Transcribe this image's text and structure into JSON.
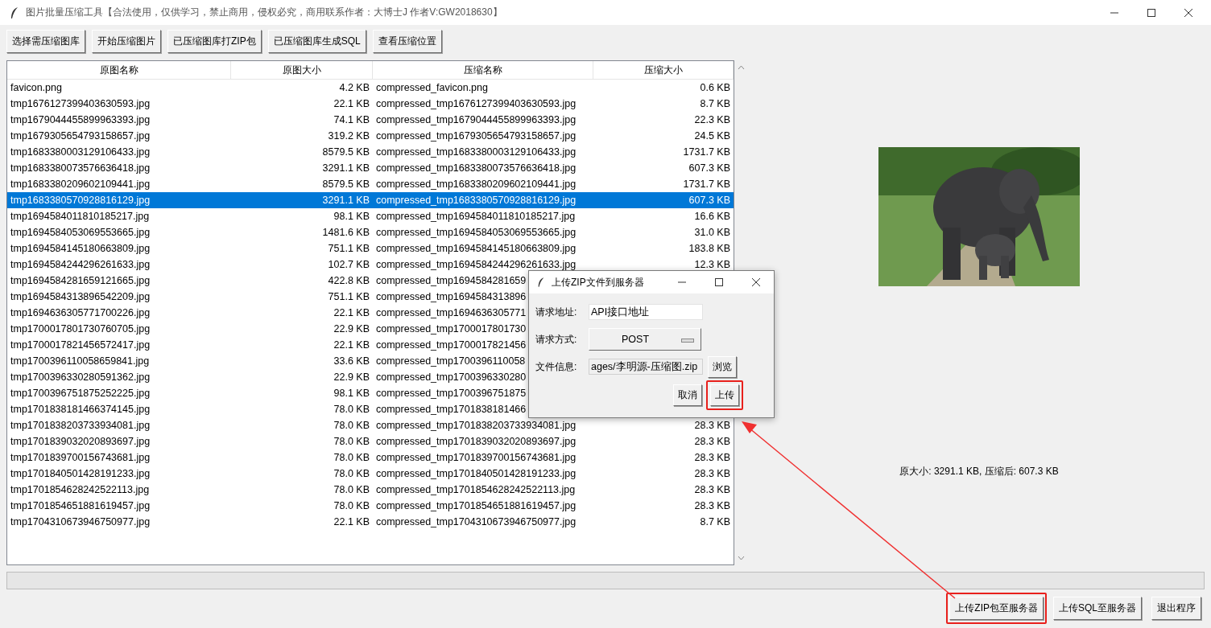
{
  "window": {
    "title": "图片批量压缩工具【合法使用，仅供学习，禁止商用，侵权必究，商用联系作者：大博士J 作者V:GW2018630】"
  },
  "toolbar": [
    "选择需压缩图库",
    "开始压缩图片",
    "已压缩图库打ZIP包",
    "已压缩图库生成SQL",
    "查看压缩位置"
  ],
  "table": {
    "columns": [
      "原图名称",
      "原图大小",
      "压缩名称",
      "压缩大小"
    ],
    "rows": [
      {
        "name": "favicon.png",
        "size": "4.2 KB",
        "compressed_name": "compressed_favicon.png",
        "compressed_size": "0.6 KB",
        "selected": false
      },
      {
        "name": "tmp1676127399403630593.jpg",
        "size": "22.1 KB",
        "compressed_name": "compressed_tmp1676127399403630593.jpg",
        "compressed_size": "8.7 KB",
        "selected": false
      },
      {
        "name": "tmp1679044455899963393.jpg",
        "size": "74.1 KB",
        "compressed_name": "compressed_tmp1679044455899963393.jpg",
        "compressed_size": "22.3 KB",
        "selected": false
      },
      {
        "name": "tmp1679305654793158657.jpg",
        "size": "319.2 KB",
        "compressed_name": "compressed_tmp1679305654793158657.jpg",
        "compressed_size": "24.5 KB",
        "selected": false
      },
      {
        "name": "tmp1683380003129106433.jpg",
        "size": "8579.5 KB",
        "compressed_name": "compressed_tmp1683380003129106433.jpg",
        "compressed_size": "1731.7 KB",
        "selected": false
      },
      {
        "name": "tmp1683380073576636418.jpg",
        "size": "3291.1 KB",
        "compressed_name": "compressed_tmp1683380073576636418.jpg",
        "compressed_size": "607.3 KB",
        "selected": false
      },
      {
        "name": "tmp1683380209602109441.jpg",
        "size": "8579.5 KB",
        "compressed_name": "compressed_tmp1683380209602109441.jpg",
        "compressed_size": "1731.7 KB",
        "selected": false
      },
      {
        "name": "tmp1683380570928816129.jpg",
        "size": "3291.1 KB",
        "compressed_name": "compressed_tmp1683380570928816129.jpg",
        "compressed_size": "607.3 KB",
        "selected": true
      },
      {
        "name": "tmp1694584011810185217.jpg",
        "size": "98.1 KB",
        "compressed_name": "compressed_tmp1694584011810185217.jpg",
        "compressed_size": "16.6 KB",
        "selected": false
      },
      {
        "name": "tmp1694584053069553665.jpg",
        "size": "1481.6 KB",
        "compressed_name": "compressed_tmp1694584053069553665.jpg",
        "compressed_size": "31.0 KB",
        "selected": false
      },
      {
        "name": "tmp1694584145180663809.jpg",
        "size": "751.1 KB",
        "compressed_name": "compressed_tmp1694584145180663809.jpg",
        "compressed_size": "183.8 KB",
        "selected": false
      },
      {
        "name": "tmp1694584244296261633.jpg",
        "size": "102.7 KB",
        "compressed_name": "compressed_tmp1694584244296261633.jpg",
        "compressed_size": "12.3 KB",
        "selected": false
      },
      {
        "name": "tmp1694584281659121665.jpg",
        "size": "422.8 KB",
        "compressed_name": "compressed_tmp1694584281659",
        "selected": false
      },
      {
        "name": "tmp1694584313896542209.jpg",
        "size": "751.1 KB",
        "compressed_name": "compressed_tmp1694584313896",
        "selected": false
      },
      {
        "name": "tmp1694636305771700226.jpg",
        "size": "22.1 KB",
        "compressed_name": "compressed_tmp1694636305771",
        "selected": false
      },
      {
        "name": "tmp1700017801730760705.jpg",
        "size": "22.9 KB",
        "compressed_name": "compressed_tmp1700017801730",
        "selected": false
      },
      {
        "name": "tmp1700017821456572417.jpg",
        "size": "22.1 KB",
        "compressed_name": "compressed_tmp1700017821456",
        "selected": false
      },
      {
        "name": "tmp1700396110058659841.jpg",
        "size": "33.6 KB",
        "compressed_name": "compressed_tmp1700396110058",
        "selected": false
      },
      {
        "name": "tmp1700396330280591362.jpg",
        "size": "22.9 KB",
        "compressed_name": "compressed_tmp1700396330280",
        "selected": false
      },
      {
        "name": "tmp1700396751875252225.jpg",
        "size": "98.1 KB",
        "compressed_name": "compressed_tmp1700396751875",
        "selected": false
      },
      {
        "name": "tmp1701838181466374145.jpg",
        "size": "78.0 KB",
        "compressed_name": "compressed_tmp1701838181466",
        "selected": false
      },
      {
        "name": "tmp1701838203733934081.jpg",
        "size": "78.0 KB",
        "compressed_name": "compressed_tmp1701838203733934081.jpg",
        "compressed_size": "28.3 KB",
        "selected": false
      },
      {
        "name": "tmp1701839032020893697.jpg",
        "size": "78.0 KB",
        "compressed_name": "compressed_tmp1701839032020893697.jpg",
        "compressed_size": "28.3 KB",
        "selected": false
      },
      {
        "name": "tmp1701839700156743681.jpg",
        "size": "78.0 KB",
        "compressed_name": "compressed_tmp1701839700156743681.jpg",
        "compressed_size": "28.3 KB",
        "selected": false
      },
      {
        "name": "tmp1701840501428191233.jpg",
        "size": "78.0 KB",
        "compressed_name": "compressed_tmp1701840501428191233.jpg",
        "compressed_size": "28.3 KB",
        "selected": false
      },
      {
        "name": "tmp1701854628242522113.jpg",
        "size": "78.0 KB",
        "compressed_name": "compressed_tmp1701854628242522113.jpg",
        "compressed_size": "28.3 KB",
        "selected": false
      },
      {
        "name": "tmp1701854651881619457.jpg",
        "size": "78.0 KB",
        "compressed_name": "compressed_tmp1701854651881619457.jpg",
        "compressed_size": "28.3 KB",
        "selected": false
      },
      {
        "name": "tmp1704310673946750977.jpg",
        "size": "22.1 KB",
        "compressed_name": "compressed_tmp1704310673946750977.jpg",
        "compressed_size": "8.7 KB",
        "selected": false
      }
    ]
  },
  "preview": {
    "caption": "原大小: 3291.1 KB, 压缩后: 607.3 KB"
  },
  "buttons": [
    {
      "label": "上传ZIP包至服务器",
      "highlighted": true
    },
    {
      "label": "上传SQL至服务器",
      "highlighted": false
    },
    {
      "label": "退出程序",
      "highlighted": false
    }
  ],
  "dialog": {
    "title": "上传ZIP文件到服务器",
    "fields": [
      {
        "kind": "text",
        "label": "请求地址:",
        "value": "API接口地址"
      },
      {
        "kind": "select",
        "label": "请求方式:",
        "value": "POST"
      },
      {
        "kind": "file",
        "label": "文件信息:",
        "value": "ages/李明源-压缩图.zip",
        "button": "浏览"
      }
    ],
    "buttons": [
      {
        "label": "取消",
        "highlighted": false
      },
      {
        "label": "上传",
        "highlighted": true
      }
    ]
  }
}
